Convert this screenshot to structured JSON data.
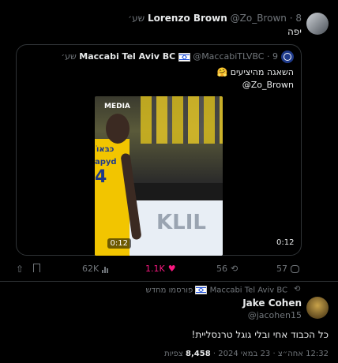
{
  "tweet": {
    "author_name": "Lorenzo Brown",
    "author_handle": "@Zo_Brown",
    "time": "8 שע׳",
    "text": "יפה"
  },
  "quoted": {
    "author_name": "Maccabi Tel Aviv BC",
    "author_handle": "@MaccabiTLVBC",
    "time": "9 שע׳",
    "text_line1": "השאגה מהיציעים 🤗",
    "text_line2": "@Zo_Brown",
    "video_overlay_logo": "MEDIA",
    "video_jersey_text": "כּבּאּוֹ",
    "video_jersey_brand": "apyd",
    "video_ad_text": "KLIL",
    "video_duration": "0:12"
  },
  "actions": {
    "views": "62K",
    "likes": "1.1K",
    "retweets": "56",
    "replies": "57"
  },
  "reply": {
    "reposted_by": "Maccabi Tel Aviv BC",
    "reposted_label": "פורסמו מחדש",
    "author_name": "Jake Cohen",
    "author_handle": "@jacohen15",
    "text": "כל הכבוד אחי ובלי גוגל טרנסליית!",
    "time": "12:32 אחה״צ",
    "date": "23 במאי 2024",
    "views_count": "8,458",
    "views_label": "צפיות"
  },
  "colors": {
    "like_pink": "#f91880",
    "muted": "#71767b",
    "border": "#2f3336"
  }
}
